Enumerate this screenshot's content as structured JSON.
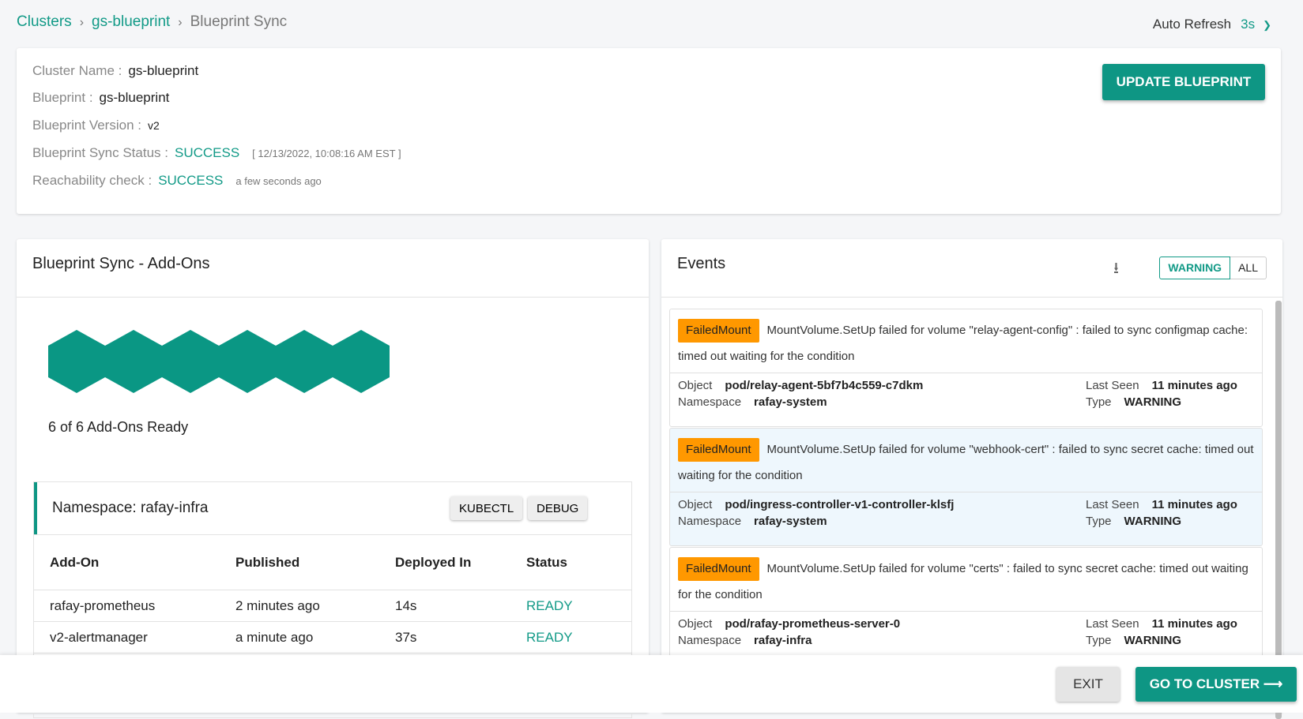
{
  "breadcrumb": [
    "Clusters",
    "gs-blueprint",
    "Blueprint Sync"
  ],
  "auto_refresh": {
    "label": "Auto Refresh",
    "value": "3s"
  },
  "info": {
    "cluster_name_label": "Cluster Name :",
    "cluster_name": "gs-blueprint",
    "blueprint_label": "Blueprint :",
    "blueprint": "gs-blueprint",
    "version_label": "Blueprint Version :",
    "version": "v2",
    "sync_status_label": "Blueprint Sync Status :",
    "sync_status": "SUCCESS",
    "sync_time": "[ 12/13/2022, 10:08:16 AM EST ]",
    "reach_label": "Reachability check :",
    "reach_status": "SUCCESS",
    "reach_time": "a few seconds ago",
    "update_button": "UPDATE BLUEPRINT"
  },
  "addons": {
    "title": "Blueprint Sync - Add-Ons",
    "ready_text": "6 of 6 Add-Ons Ready",
    "ready_count": 6,
    "total": 6,
    "namespace": "Namespace: rafay-infra",
    "kubectl": "KUBECTL",
    "debug": "DEBUG",
    "columns": [
      "Add-On",
      "Published",
      "Deployed In",
      "Status"
    ],
    "rows": [
      [
        "rafay-prometheus",
        "2 minutes ago",
        "14s",
        "READY"
      ],
      [
        "v2-alertmanager",
        "a minute ago",
        "37s",
        "READY"
      ]
    ]
  },
  "events": {
    "title": "Events",
    "filter_warning": "WARNING",
    "filter_all": "ALL",
    "object_label": "Object",
    "namespace_label": "Namespace",
    "last_seen_label": "Last Seen",
    "type_label": "Type",
    "items": [
      {
        "reason": "FailedMount",
        "message": "MountVolume.SetUp failed for volume \"relay-agent-config\" : failed to sync configmap cache: timed out waiting for the condition",
        "object": "pod/relay-agent-5bf7b4c559-c7dkm",
        "namespace": "rafay-system",
        "last_seen": "11 minutes ago",
        "type": "WARNING"
      },
      {
        "reason": "FailedMount",
        "message": "MountVolume.SetUp failed for volume \"webhook-cert\" : failed to sync secret cache: timed out waiting for the condition",
        "object": "pod/ingress-controller-v1-controller-klsfj",
        "namespace": "rafay-system",
        "last_seen": "11 minutes ago",
        "type": "WARNING"
      },
      {
        "reason": "FailedMount",
        "message": "MountVolume.SetUp failed for volume \"certs\" : failed to sync secret cache: timed out waiting for the condition",
        "object": "pod/rafay-prometheus-server-0",
        "namespace": "rafay-infra",
        "last_seen": "11 minutes ago",
        "type": "WARNING"
      }
    ]
  },
  "footer": {
    "exit": "EXIT",
    "go": "GO TO CLUSTER"
  },
  "colors": {
    "accent": "#0e9684",
    "badge": "#ff9800"
  }
}
